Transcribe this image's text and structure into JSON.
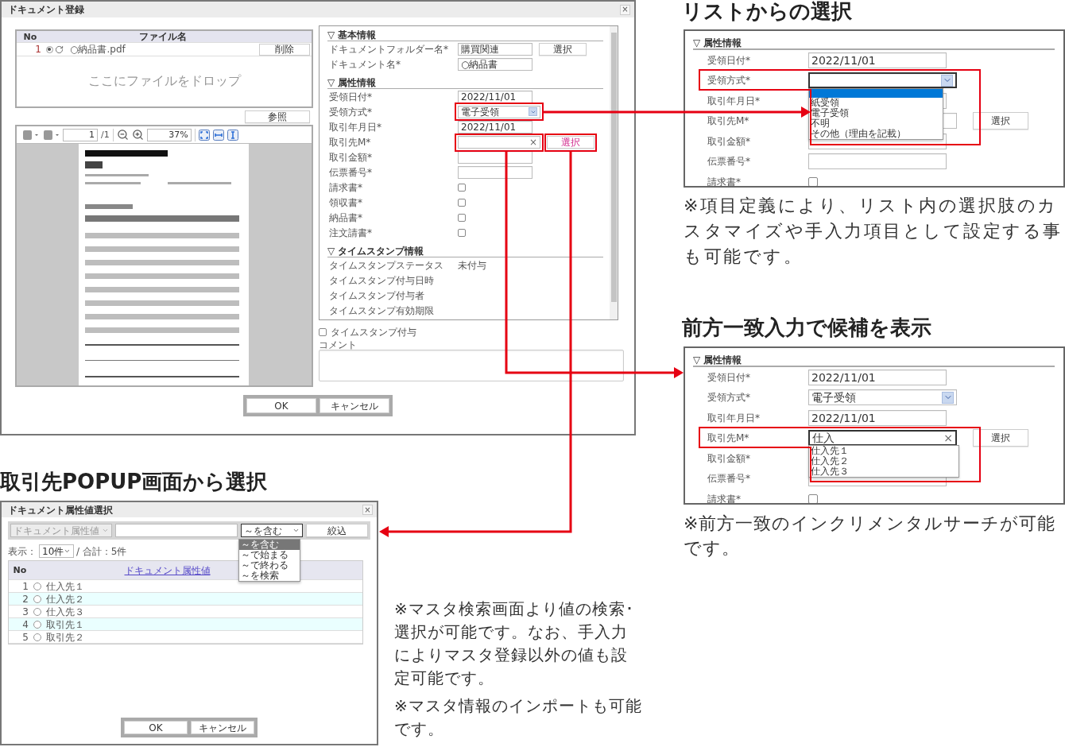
{
  "registration_dialog": {
    "title": "ドキュメント登録",
    "close": "×",
    "file_table": {
      "columns": [
        "No",
        "ファイル名"
      ],
      "rows": [
        {
          "no": "1",
          "selected": true,
          "name": "○納品書.pdf",
          "action": "削除"
        }
      ],
      "drop_hint": "ここにファイルをドロップ"
    },
    "browse_button": "参照",
    "viewer": {
      "page": "1",
      "page_count": "/1",
      "zoom": "37%"
    },
    "sections": [
      {
        "title": "▽ 基本情報",
        "fields": [
          {
            "kind": "text",
            "label": "ドキュメントフォルダー名*",
            "value": "購買関連",
            "button": "選択"
          },
          {
            "kind": "text",
            "label": "ドキュメント名*",
            "value": "○納品書"
          }
        ]
      },
      {
        "title": "▽ 属性情報",
        "fields": [
          {
            "kind": "text",
            "label": "受領日付*",
            "value": "2022/11/01"
          },
          {
            "kind": "select",
            "label": "受領方式*",
            "value": "電子受領"
          },
          {
            "kind": "text",
            "label": "取引年月日*",
            "value": "2022/11/01"
          },
          {
            "kind": "clearable",
            "label": "取引先M*",
            "clear": "×",
            "button": "選択",
            "button_hover": true
          },
          {
            "kind": "text",
            "label": "取引金額*"
          },
          {
            "kind": "text",
            "label": "伝票番号*"
          },
          {
            "kind": "checkbox",
            "label": "請求書*",
            "checked": false
          },
          {
            "kind": "checkbox",
            "label": "領収書*",
            "checked": false
          },
          {
            "kind": "checkbox",
            "label": "納品書*",
            "checked": false
          },
          {
            "kind": "checkbox",
            "label": "注文請書*",
            "checked": false
          }
        ]
      },
      {
        "title": "▽ タイムスタンプ情報",
        "fields": [
          {
            "kind": "readonly",
            "label": "タイムスタンプステータス",
            "value": "未付与"
          },
          {
            "kind": "readonly",
            "label": "タイムスタンプ付与日時"
          },
          {
            "kind": "readonly",
            "label": "タイムスタンプ付与者"
          },
          {
            "kind": "readonly",
            "label": "タイムスタンプ有効期限"
          }
        ]
      }
    ],
    "timestamp_option": {
      "label": "タイムスタンプ付与",
      "checked": false
    },
    "comment": {
      "label": "コメント"
    },
    "buttons": [
      "OK",
      "キャンセル"
    ]
  },
  "list_callout": {
    "heading": "リストからの選択",
    "section_title": "▽ 属性情報",
    "fields": [
      {
        "kind": "text",
        "label": "受領日付*",
        "value": "2022/11/01"
      },
      {
        "kind": "select",
        "label": "受領方式*",
        "open": true,
        "empty_option_selected": true,
        "options": [
          "紙受領",
          "電子受領",
          "不明",
          "その他（理由を記載）"
        ]
      },
      {
        "kind": "text",
        "label": "取引年月日*"
      },
      {
        "kind": "clearable",
        "label": "取引先M*",
        "button": "選択",
        "button_hover": false
      },
      {
        "kind": "text",
        "label": "取引金額*"
      },
      {
        "kind": "text",
        "label": "伝票番号*"
      },
      {
        "kind": "checkbox",
        "label": "請求書*",
        "checked": false
      }
    ],
    "note": "※項目定義により、リスト内の選択肢のカスタマイズや手入力項目として設定する事も可能です。"
  },
  "prefix_callout": {
    "heading": "前方一致入力で候補を表示",
    "section_title": "▽ 属性情報",
    "fields": [
      {
        "kind": "text",
        "label": "受領日付*",
        "value": "2022/11/01"
      },
      {
        "kind": "select",
        "label": "受領方式*",
        "value": "電子受領"
      },
      {
        "kind": "text",
        "label": "取引年月日*",
        "value": "2022/11/01"
      },
      {
        "kind": "clearable",
        "label": "取引先M*",
        "value": "仕入",
        "clear": "×",
        "focused": true,
        "suggestions": [
          "仕入先１",
          "仕入先２",
          "仕入先３"
        ],
        "button": "選択",
        "button_hover": false
      },
      {
        "kind": "label_only",
        "label": "取引金額*"
      },
      {
        "kind": "text",
        "label": "伝票番号*"
      },
      {
        "kind": "checkbox",
        "label": "請求書*",
        "checked": false
      }
    ],
    "note": "※前方一致のインクリメンタルサーチが可能です。"
  },
  "popup_callout": {
    "heading": "取引先POPUP画面から選択",
    "popup": {
      "title": "ドキュメント属性値選択",
      "close": "×",
      "filter": {
        "attribute": "ドキュメント属性値",
        "attribute_disabled": true,
        "match": "～を含む",
        "match_open": true,
        "match_options": [
          {
            "label": "～を含む",
            "selected": true
          },
          {
            "label": "～で始まる",
            "selected": false
          },
          {
            "label": "～で終わる",
            "selected": false
          },
          {
            "label": "～を検索",
            "selected": false
          }
        ],
        "button": "絞込"
      },
      "page_size_label": "表示：",
      "page_size": "10件",
      "total": "/ 合計：5件",
      "columns": [
        "No",
        "ドキュメント属性値"
      ],
      "rows": [
        {
          "no": "1",
          "value": "仕入先１",
          "selected": false
        },
        {
          "no": "2",
          "value": "仕入先２",
          "selected": false
        },
        {
          "no": "3",
          "value": "仕入先３",
          "selected": false
        },
        {
          "no": "4",
          "value": "取引先１",
          "selected": false
        },
        {
          "no": "5",
          "value": "取引先２",
          "selected": false
        }
      ],
      "buttons": [
        "OK",
        "キャンセル"
      ]
    },
    "notes": [
      "※マスタ検索画面より値の検索･選択が可能です。なお、手入力によりマスタ登録以外の値も設定可能です。",
      "※マスタ情報のインポートも可能です。"
    ]
  }
}
